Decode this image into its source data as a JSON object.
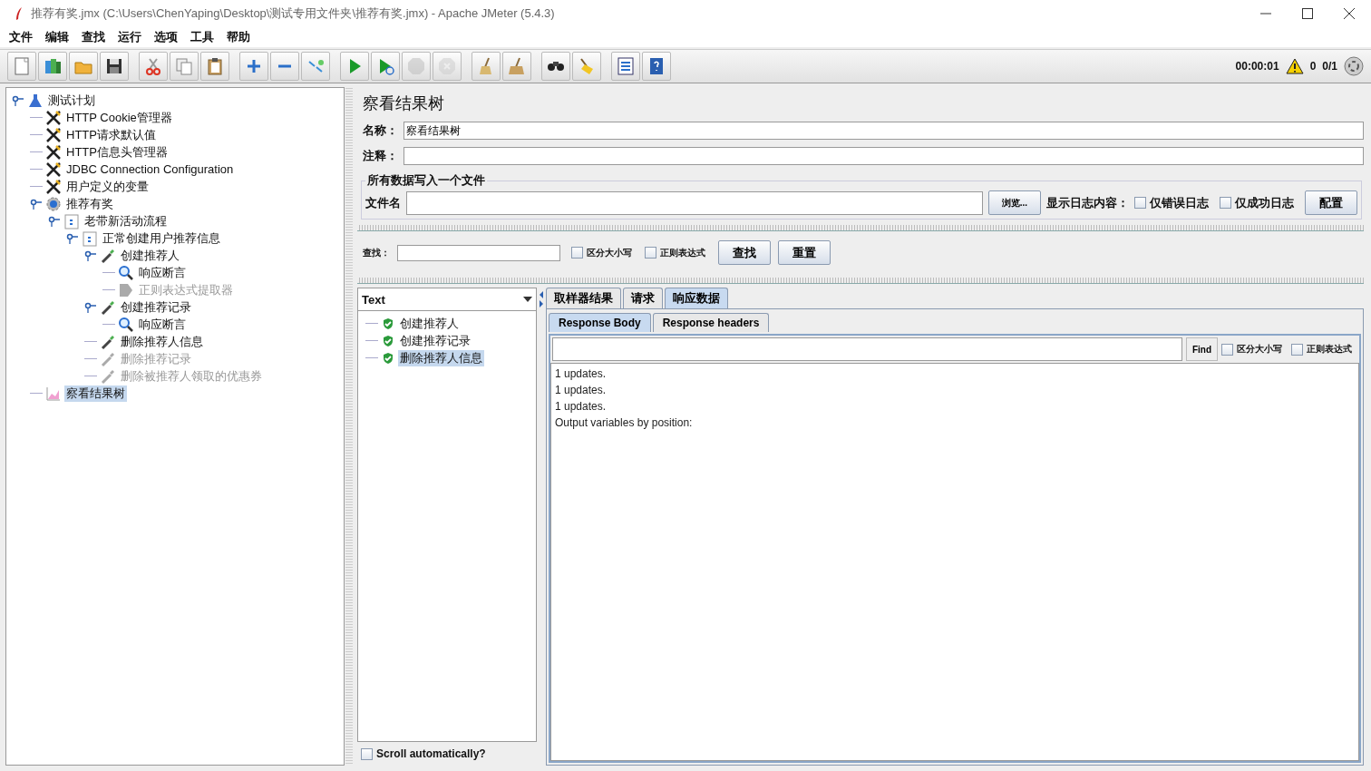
{
  "window": {
    "title": "推荐有奖.jmx (C:\\Users\\ChenYaping\\Desktop\\测试专用文件夹\\推荐有奖.jmx) - Apache JMeter (5.4.3)"
  },
  "menu": [
    "文件",
    "编辑",
    "查找",
    "运行",
    "选项",
    "工具",
    "帮助"
  ],
  "toolbar": [
    {
      "buttons": [
        {
          "kind": "new",
          "disabled": false
        },
        {
          "kind": "templates",
          "disabled": false
        },
        {
          "kind": "open",
          "disabled": false
        },
        {
          "kind": "save",
          "disabled": false
        }
      ]
    },
    {
      "buttons": [
        {
          "kind": "cut",
          "disabled": false
        },
        {
          "kind": "copy",
          "disabled": false
        },
        {
          "kind": "paste",
          "disabled": false
        }
      ]
    },
    {
      "buttons": [
        {
          "kind": "expand",
          "disabled": false
        },
        {
          "kind": "collapse",
          "disabled": false
        },
        {
          "kind": "toggle",
          "disabled": false
        }
      ]
    },
    {
      "buttons": [
        {
          "kind": "start",
          "disabled": false
        },
        {
          "kind": "start-no-pause",
          "disabled": false
        },
        {
          "kind": "stop",
          "disabled": true
        },
        {
          "kind": "shutdown",
          "disabled": true
        }
      ]
    },
    {
      "buttons": [
        {
          "kind": "clear",
          "disabled": false
        },
        {
          "kind": "clear-all",
          "disabled": false
        }
      ]
    },
    {
      "buttons": [
        {
          "kind": "search",
          "disabled": false
        },
        {
          "kind": "reset-search",
          "disabled": false
        }
      ]
    },
    {
      "buttons": [
        {
          "kind": "function-helper",
          "disabled": false
        },
        {
          "kind": "help",
          "disabled": false
        }
      ]
    }
  ],
  "status": {
    "elapsed": "00:00:01",
    "warnings": "0",
    "threads": "0/1"
  },
  "tree": [
    {
      "label": "测试计划",
      "kind": "plan",
      "enabled": true,
      "selected": false,
      "expanded": true,
      "children": [
        {
          "label": "HTTP Cookie管理器",
          "kind": "config",
          "enabled": true,
          "selected": false
        },
        {
          "label": "HTTP请求默认值",
          "kind": "config",
          "enabled": true,
          "selected": false
        },
        {
          "label": "HTTP信息头管理器",
          "kind": "config",
          "enabled": true,
          "selected": false
        },
        {
          "label": "JDBC Connection Configuration",
          "kind": "config",
          "enabled": true,
          "selected": false
        },
        {
          "label": "用户定义的变量",
          "kind": "config",
          "enabled": true,
          "selected": false
        },
        {
          "label": "推荐有奖",
          "kind": "thread",
          "enabled": true,
          "selected": false,
          "expanded": true,
          "children": [
            {
              "label": "老带新活动流程",
              "kind": "controller",
              "enabled": true,
              "selected": false,
              "expanded": true,
              "children": [
                {
                  "label": "正常创建用户推荐信息",
                  "kind": "controller",
                  "enabled": true,
                  "selected": false,
                  "expanded": true,
                  "children": [
                    {
                      "label": "创建推荐人",
                      "kind": "sampler",
                      "enabled": true,
                      "selected": false,
                      "expanded": true,
                      "children": [
                        {
                          "label": "响应断言",
                          "kind": "assertion",
                          "enabled": true,
                          "selected": false
                        },
                        {
                          "label": "正则表达式提取器",
                          "kind": "extractor",
                          "enabled": false,
                          "selected": false
                        }
                      ]
                    },
                    {
                      "label": "创建推荐记录",
                      "kind": "sampler",
                      "enabled": true,
                      "selected": false,
                      "expanded": true,
                      "children": [
                        {
                          "label": "响应断言",
                          "kind": "assertion",
                          "enabled": true,
                          "selected": false
                        }
                      ]
                    },
                    {
                      "label": "删除推荐人信息",
                      "kind": "sampler",
                      "enabled": true,
                      "selected": false
                    },
                    {
                      "label": "删除推荐记录",
                      "kind": "sampler",
                      "enabled": false,
                      "selected": false
                    },
                    {
                      "label": "删除被推荐人领取的优惠券",
                      "kind": "sampler",
                      "enabled": false,
                      "selected": false
                    }
                  ]
                }
              ]
            }
          ]
        },
        {
          "label": "察看结果树",
          "kind": "listener",
          "enabled": true,
          "selected": true
        }
      ]
    }
  ],
  "panel": {
    "title": "察看结果树",
    "name_label": "名称：",
    "name_value": "察看结果树",
    "comment_label": "注释：",
    "file_group": {
      "legend": "所有数据写入一个文件",
      "filename_label": "文件名",
      "browse": "浏览...",
      "log_label": "显示日志内容：",
      "options": [
        {
          "label": "仅错误日志",
          "checked": false
        },
        {
          "label": "仅成功日志",
          "checked": false
        }
      ],
      "configure": "配置"
    },
    "search": {
      "label": "查找：",
      "options": [
        {
          "label": "区分大小写",
          "checked": false
        },
        {
          "label": "正则表达式",
          "checked": false
        }
      ],
      "find": "查找",
      "reset": "重置"
    },
    "renderer": "Text",
    "samples": [
      {
        "label": "创建推荐人",
        "success": true,
        "selected": false
      },
      {
        "label": "创建推荐记录",
        "success": true,
        "selected": false
      },
      {
        "label": "删除推荐人信息",
        "success": true,
        "selected": true
      }
    ],
    "scroll": {
      "label": "Scroll automatically?",
      "checked": false
    },
    "tabs": [
      {
        "label": "取样器结果",
        "selected": false
      },
      {
        "label": "请求",
        "selected": false
      },
      {
        "label": "响应数据",
        "selected": true
      }
    ],
    "subtabs": [
      {
        "label": "Response Body",
        "selected": true
      },
      {
        "label": "Response headers",
        "selected": false
      }
    ],
    "body_search": {
      "find": "Find",
      "options": [
        {
          "label": "区分大小写",
          "checked": false
        },
        {
          "label": "正则表达式",
          "checked": false
        }
      ]
    },
    "body": [
      "1 updates.",
      "1 updates.",
      "1 updates.",
      "Output variables by position:"
    ]
  }
}
